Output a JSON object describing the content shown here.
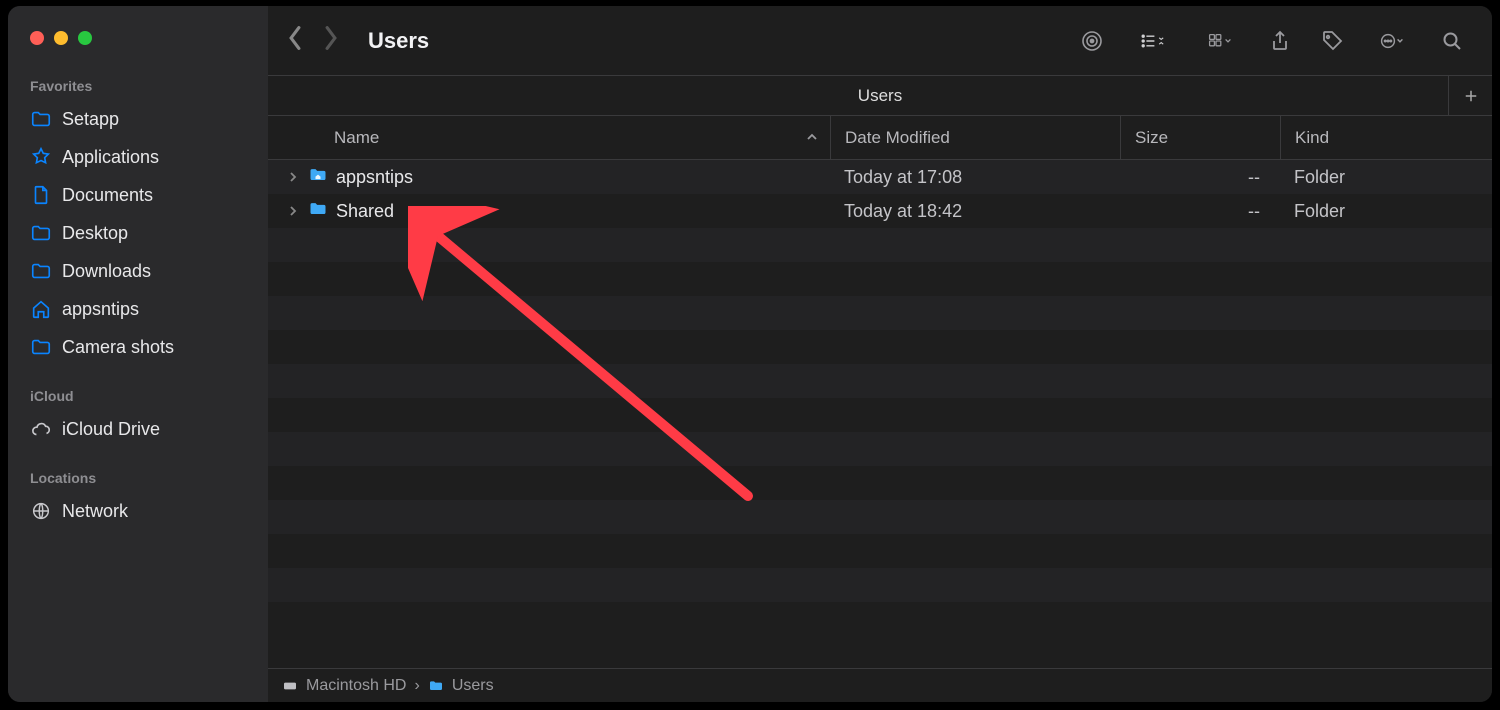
{
  "window": {
    "title": "Users"
  },
  "colors": {
    "close": "#ff5f57",
    "min": "#febc2e",
    "max": "#28c840",
    "accent": "#0a84ff",
    "folder": "#3fa9f5",
    "annotation": "#ff3b46"
  },
  "sidebar": {
    "sections": [
      {
        "label": "Favorites",
        "items": [
          {
            "icon": "folder",
            "label": "Setapp"
          },
          {
            "icon": "app",
            "label": "Applications"
          },
          {
            "icon": "doc",
            "label": "Documents"
          },
          {
            "icon": "folder",
            "label": "Desktop"
          },
          {
            "icon": "folder",
            "label": "Downloads"
          },
          {
            "icon": "home",
            "label": "appsntips"
          },
          {
            "icon": "folder",
            "label": "Camera shots"
          }
        ]
      },
      {
        "label": "iCloud",
        "items": [
          {
            "icon": "cloud",
            "label": "iCloud Drive"
          }
        ]
      },
      {
        "label": "Locations",
        "items": [
          {
            "icon": "globe",
            "label": "Network"
          }
        ]
      }
    ]
  },
  "tab": {
    "title": "Users"
  },
  "columns": {
    "name": "Name",
    "date": "Date Modified",
    "size": "Size",
    "kind": "Kind"
  },
  "rows": [
    {
      "name": "appsntips",
      "icon": "home-folder",
      "date": "Today at 17:08",
      "size": "--",
      "kind": "Folder"
    },
    {
      "name": "Shared",
      "icon": "folder",
      "date": "Today at 18:42",
      "size": "--",
      "kind": "Folder"
    }
  ],
  "blank_rows": 11,
  "pathbar": {
    "disk": "Macintosh HD",
    "sep": "›",
    "folder": "Users"
  },
  "annotation": {
    "type": "arrow",
    "points_to": "Shared folder row",
    "color": "#ff3b46"
  }
}
